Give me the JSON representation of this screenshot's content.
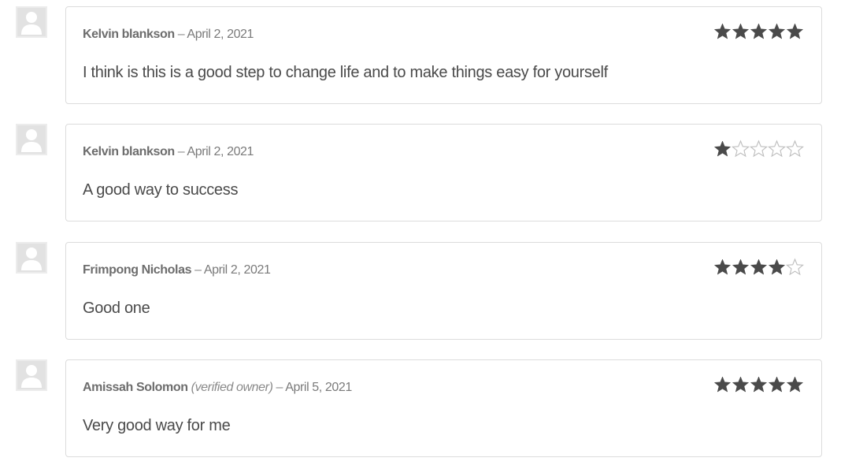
{
  "reviews": [
    {
      "author": "Kelvin blankson",
      "verified": "",
      "dash": "–",
      "date": "April 2, 2021",
      "text": "I think is this is a good step to change life and to make things easy for yourself",
      "rating": 5,
      "max_rating": 5
    },
    {
      "author": "Kelvin blankson",
      "verified": "",
      "dash": "–",
      "date": "April 2, 2021",
      "text": "A good way to success",
      "rating": 1,
      "max_rating": 5
    },
    {
      "author": "Frimpong Nicholas",
      "verified": "",
      "dash": "–",
      "date": "April 2, 2021",
      "text": "Good one",
      "rating": 4,
      "max_rating": 5
    },
    {
      "author": "Amissah Solomon",
      "verified": "(verified owner)",
      "dash": "–",
      "date": "April 5, 2021",
      "text": "Very good way for me",
      "rating": 5,
      "max_rating": 5
    }
  ],
  "colors": {
    "star_filled": "#4a4a4a",
    "star_empty_stroke": "#bdbdbd",
    "avatar_bg": "#e2e2e2",
    "avatar_fg": "#ffffff"
  },
  "icons": {
    "avatar": "user-silhouette-icon",
    "rating": "star-icon"
  }
}
